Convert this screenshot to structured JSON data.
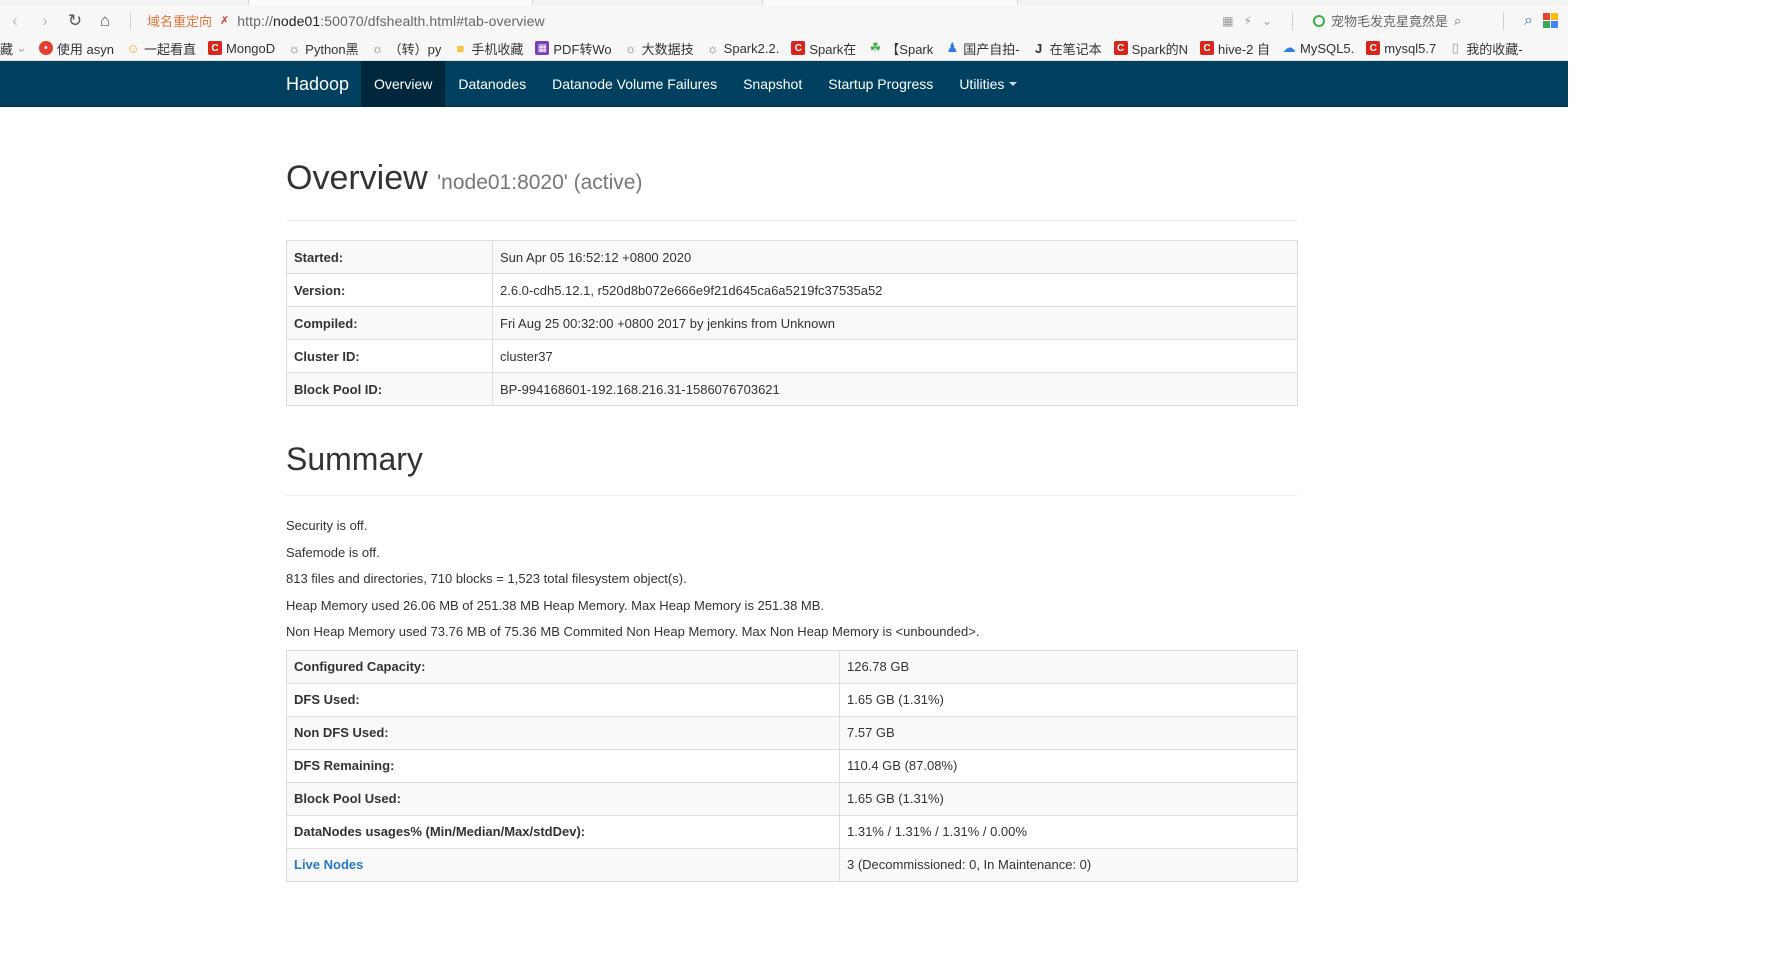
{
  "browser": {
    "redirect_label": "域名重定向",
    "url_scheme": "http://",
    "url_host": "node01",
    "url_rest": ":50070/dfshealth.html#tab-overview",
    "search_text": "宠物毛发克星竟然是",
    "bookmarks": [
      {
        "label": "藏",
        "icon": "",
        "color": ""
      },
      {
        "label": "使用 asyn",
        "icon": "red-circle-icon",
        "color": "#e53e30"
      },
      {
        "label": "一起看直",
        "icon": "face-icon",
        "color": "#f1a83a"
      },
      {
        "label": "MongoD",
        "icon": "c-icon",
        "color": "#d9261c"
      },
      {
        "label": "Python黑",
        "icon": "swirl-icon",
        "color": "#777777"
      },
      {
        "label": "（转）py",
        "icon": "swirl-icon",
        "color": "#777777"
      },
      {
        "label": "手机收藏",
        "icon": "folder-icon",
        "color": "#f5c242"
      },
      {
        "label": "PDF转Wo",
        "icon": "grid-icon",
        "color": "#7b3fb8"
      },
      {
        "label": "大数据技",
        "icon": "swirl-icon",
        "color": "#777777"
      },
      {
        "label": "Spark2.2.",
        "icon": "swirl-icon",
        "color": "#777777"
      },
      {
        "label": "Spark在",
        "icon": "c-icon",
        "color": "#d9261c"
      },
      {
        "label": "【Spark",
        "icon": "leaf-icon",
        "color": "#3fae49"
      },
      {
        "label": "国产自拍-",
        "icon": "person-icon",
        "color": "#2d7be5"
      },
      {
        "label": "在笔记本",
        "icon": "j-icon",
        "color": "#333333"
      },
      {
        "label": "Spark的N",
        "icon": "c-icon",
        "color": "#d9261c"
      },
      {
        "label": "hive-2 自",
        "icon": "c-icon",
        "color": "#d9261c"
      },
      {
        "label": "MySQL5.",
        "icon": "cloud-icon",
        "color": "#2d7be5"
      },
      {
        "label": "mysql5.7",
        "icon": "c-icon",
        "color": "#d9261c"
      },
      {
        "label": "我的收藏-",
        "icon": "page-icon",
        "color": "#999999"
      }
    ]
  },
  "navbar": {
    "brand": "Hadoop",
    "items": [
      {
        "label": "Overview",
        "active": true
      },
      {
        "label": "Datanodes",
        "active": false
      },
      {
        "label": "Datanode Volume Failures",
        "active": false
      },
      {
        "label": "Snapshot",
        "active": false
      },
      {
        "label": "Startup Progress",
        "active": false
      },
      {
        "label": "Utilities",
        "active": false
      }
    ],
    "bg_color": "#01405f"
  },
  "overview": {
    "title": "Overview",
    "subtitle": "'node01:8020' (active)",
    "rows": [
      {
        "key": "Started:",
        "value": "Sun Apr 05 16:52:12 +0800 2020"
      },
      {
        "key": "Version:",
        "value": "2.6.0-cdh5.12.1, r520d8b072e666e9f21d645ca6a5219fc37535a52"
      },
      {
        "key": "Compiled:",
        "value": "Fri Aug 25 00:32:00 +0800 2017 by jenkins from Unknown"
      },
      {
        "key": "Cluster ID:",
        "value": "cluster37"
      },
      {
        "key": "Block Pool ID:",
        "value": "BP-994168601-192.168.216.31-1586076703621"
      }
    ]
  },
  "summary": {
    "title": "Summary",
    "lines": [
      "Security is off.",
      "Safemode is off.",
      "813 files and directories, 710 blocks = 1,523 total filesystem object(s).",
      "Heap Memory used 26.06 MB of 251.38 MB Heap Memory. Max Heap Memory is 251.38 MB.",
      "Non Heap Memory used 73.76 MB of 75.36 MB Commited Non Heap Memory. Max Non Heap Memory is <unbounded>."
    ],
    "rows": [
      {
        "key": "Configured Capacity:",
        "value": "126.78 GB",
        "link": false
      },
      {
        "key": "DFS Used:",
        "value": "1.65 GB (1.31%)",
        "link": false
      },
      {
        "key": "Non DFS Used:",
        "value": "7.57 GB",
        "link": false
      },
      {
        "key": "DFS Remaining:",
        "value": "110.4 GB (87.08%)",
        "link": false
      },
      {
        "key": "Block Pool Used:",
        "value": "1.65 GB (1.31%)",
        "link": false
      },
      {
        "key": "DataNodes usages% (Min/Median/Max/stdDev):",
        "value": "1.31% / 1.31% / 1.31% / 0.00%",
        "link": false
      },
      {
        "key": "Live Nodes",
        "value": "3 (Decommissioned: 0, In Maintenance: 0)",
        "link": true
      }
    ]
  }
}
